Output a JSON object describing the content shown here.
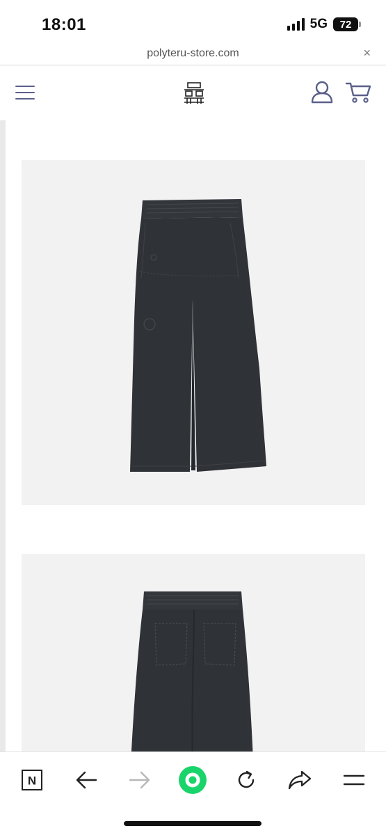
{
  "status_bar": {
    "time": "18:01",
    "network": "5G",
    "battery": "72"
  },
  "url_bar": {
    "url": "polyteru-store.com",
    "close_label": "×"
  },
  "header": {
    "menu_icon": "hamburger-icon",
    "logo_icon": "brand-logo",
    "account_icon": "user-icon",
    "cart_icon": "cart-icon",
    "accent_color": "#5a5f8a"
  },
  "products": {
    "images": [
      {
        "subject": "pants-front-view",
        "color": "#2f3236"
      },
      {
        "subject": "pants-back-view",
        "color": "#2f3236"
      }
    ]
  },
  "toolbar": {
    "n_label": "N",
    "icons": [
      "naver-n-icon",
      "back-arrow-icon",
      "forward-arrow-icon",
      "green-dot-icon",
      "reload-icon",
      "share-icon",
      "menu-icon"
    ],
    "green_color": "#19d46a"
  }
}
